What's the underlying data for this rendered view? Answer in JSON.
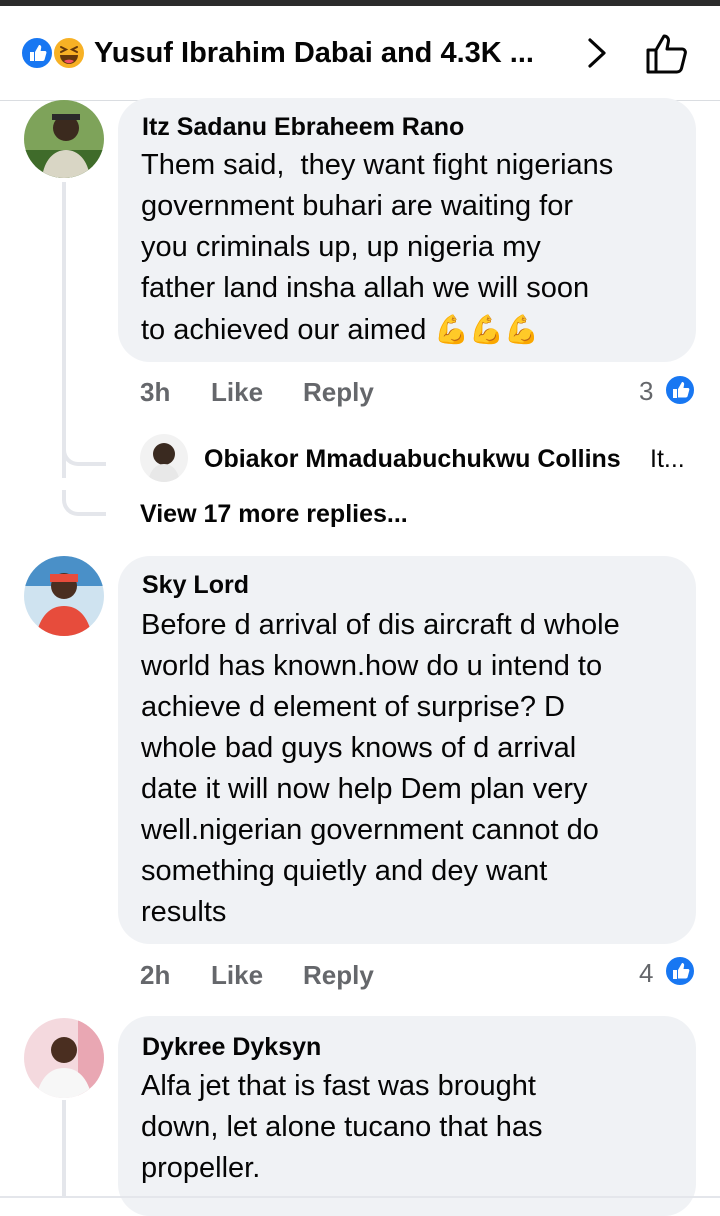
{
  "header": {
    "title": "Yusuf Ibrahim Dabai and 4.3K ...",
    "reactions": [
      "like-reaction",
      "haha-reaction"
    ],
    "chevron_icon": "chevron-right-icon",
    "like_icon": "thumbs-up-outline-icon"
  },
  "comments": [
    {
      "author": "Itz Sadanu Ebraheem Rano",
      "text": "Them said,  they want fight nigerians\ngovernment buhari are waiting for\nyou criminals up, up nigeria my\nfather land insha allah we will soon\nto achieved our aimed",
      "emoji": "💪💪💪",
      "time": "3h",
      "like_label": "Like",
      "reply_label": "Reply",
      "reaction_count": "3",
      "reply_preview": {
        "author": "Obiakor Mmaduabuchukwu Collins",
        "snippet": "It..."
      },
      "view_more": "View 17 more replies..."
    },
    {
      "author": "Sky Lord",
      "text": "Before d arrival of dis aircraft d whole\nworld has known.how do u intend to\nachieve d element of surprise? D\nwhole bad guys knows of d arrival\ndate it will now help Dem plan very\nwell.nigerian government cannot do\nsomething quietly and dey want\nresults",
      "time": "2h",
      "like_label": "Like",
      "reply_label": "Reply",
      "reaction_count": "4"
    },
    {
      "author": "Dykree Dyksyn",
      "text": "Alfa jet that is fast was brought\ndown, let alone tucano that has\npropeller."
    }
  ],
  "colors": {
    "facebook_blue": "#1877f2",
    "bubble_bg": "#f0f2f5",
    "secondary_text": "#65676b",
    "thread_line": "#e4e6eb"
  }
}
